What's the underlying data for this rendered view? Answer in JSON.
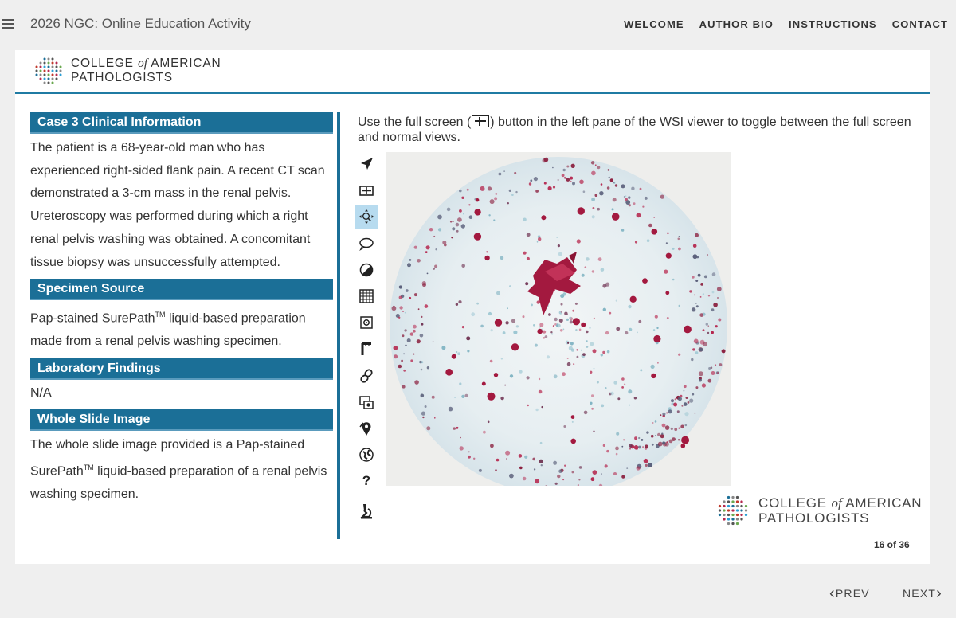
{
  "app": {
    "title": "2026 NGC: Online Education Activity"
  },
  "topnav": [
    "WELCOME",
    "AUTHOR BIO",
    "INSTRUCTIONS",
    "CONTACT"
  ],
  "brand": {
    "line1_a": "COLLEGE ",
    "line1_of": "of",
    "line1_b": " AMERICAN",
    "line2": "PATHOLOGISTS"
  },
  "sections": [
    {
      "heading": "Case 3 Clinical Information",
      "body": "The patient is a 68-year-old man who has experienced right-sided flank pain. A recent CT scan demonstrated a 3-cm mass in the renal pelvis. Ureteroscopy was performed during which a right renal pelvis washing was obtained. A concomitant tissue biopsy was unsuccessfully attempted."
    },
    {
      "heading": "Specimen Source",
      "body_a": "Pap-stained SurePath",
      "body_tm": "TM",
      "body_b": " liquid-based preparation made from a renal pelvis washing specimen."
    },
    {
      "heading": "Laboratory Findings",
      "body": "N/A"
    },
    {
      "heading": "Whole Slide Image",
      "body_a": "The whole slide image provided is a Pap-stained SurePath",
      "body_tm": "TM",
      "body_b": " liquid-based preparation of a renal pelvis washing specimen."
    }
  ],
  "instruction": {
    "before": "Use the full screen (",
    "after": ") button in the left pane of the WSI viewer to toggle between the full screen and normal views."
  },
  "toolbar": {
    "tools": [
      "pointer-icon",
      "fullscreen-icon",
      "pan-zoom-icon",
      "comment-icon",
      "contrast-icon",
      "grid-icon",
      "snapshot-icon",
      "ruler-icon",
      "link-icon",
      "camera-icon",
      "annotation-pin-icon",
      "globe-icon",
      "help-icon",
      "microscope-icon"
    ],
    "active": "pan-zoom-icon",
    "help_label": "?"
  },
  "colors": {
    "accent": "#1b6f97",
    "header_rule": "#1f7ba3",
    "active_tool": "#b7dbef",
    "stain_pink": "#b5284f",
    "stain_blue": "#a9cfd8"
  },
  "pagination": {
    "current": "16 of 36"
  },
  "nav": {
    "prev": "PREV",
    "next": "NEXT"
  }
}
